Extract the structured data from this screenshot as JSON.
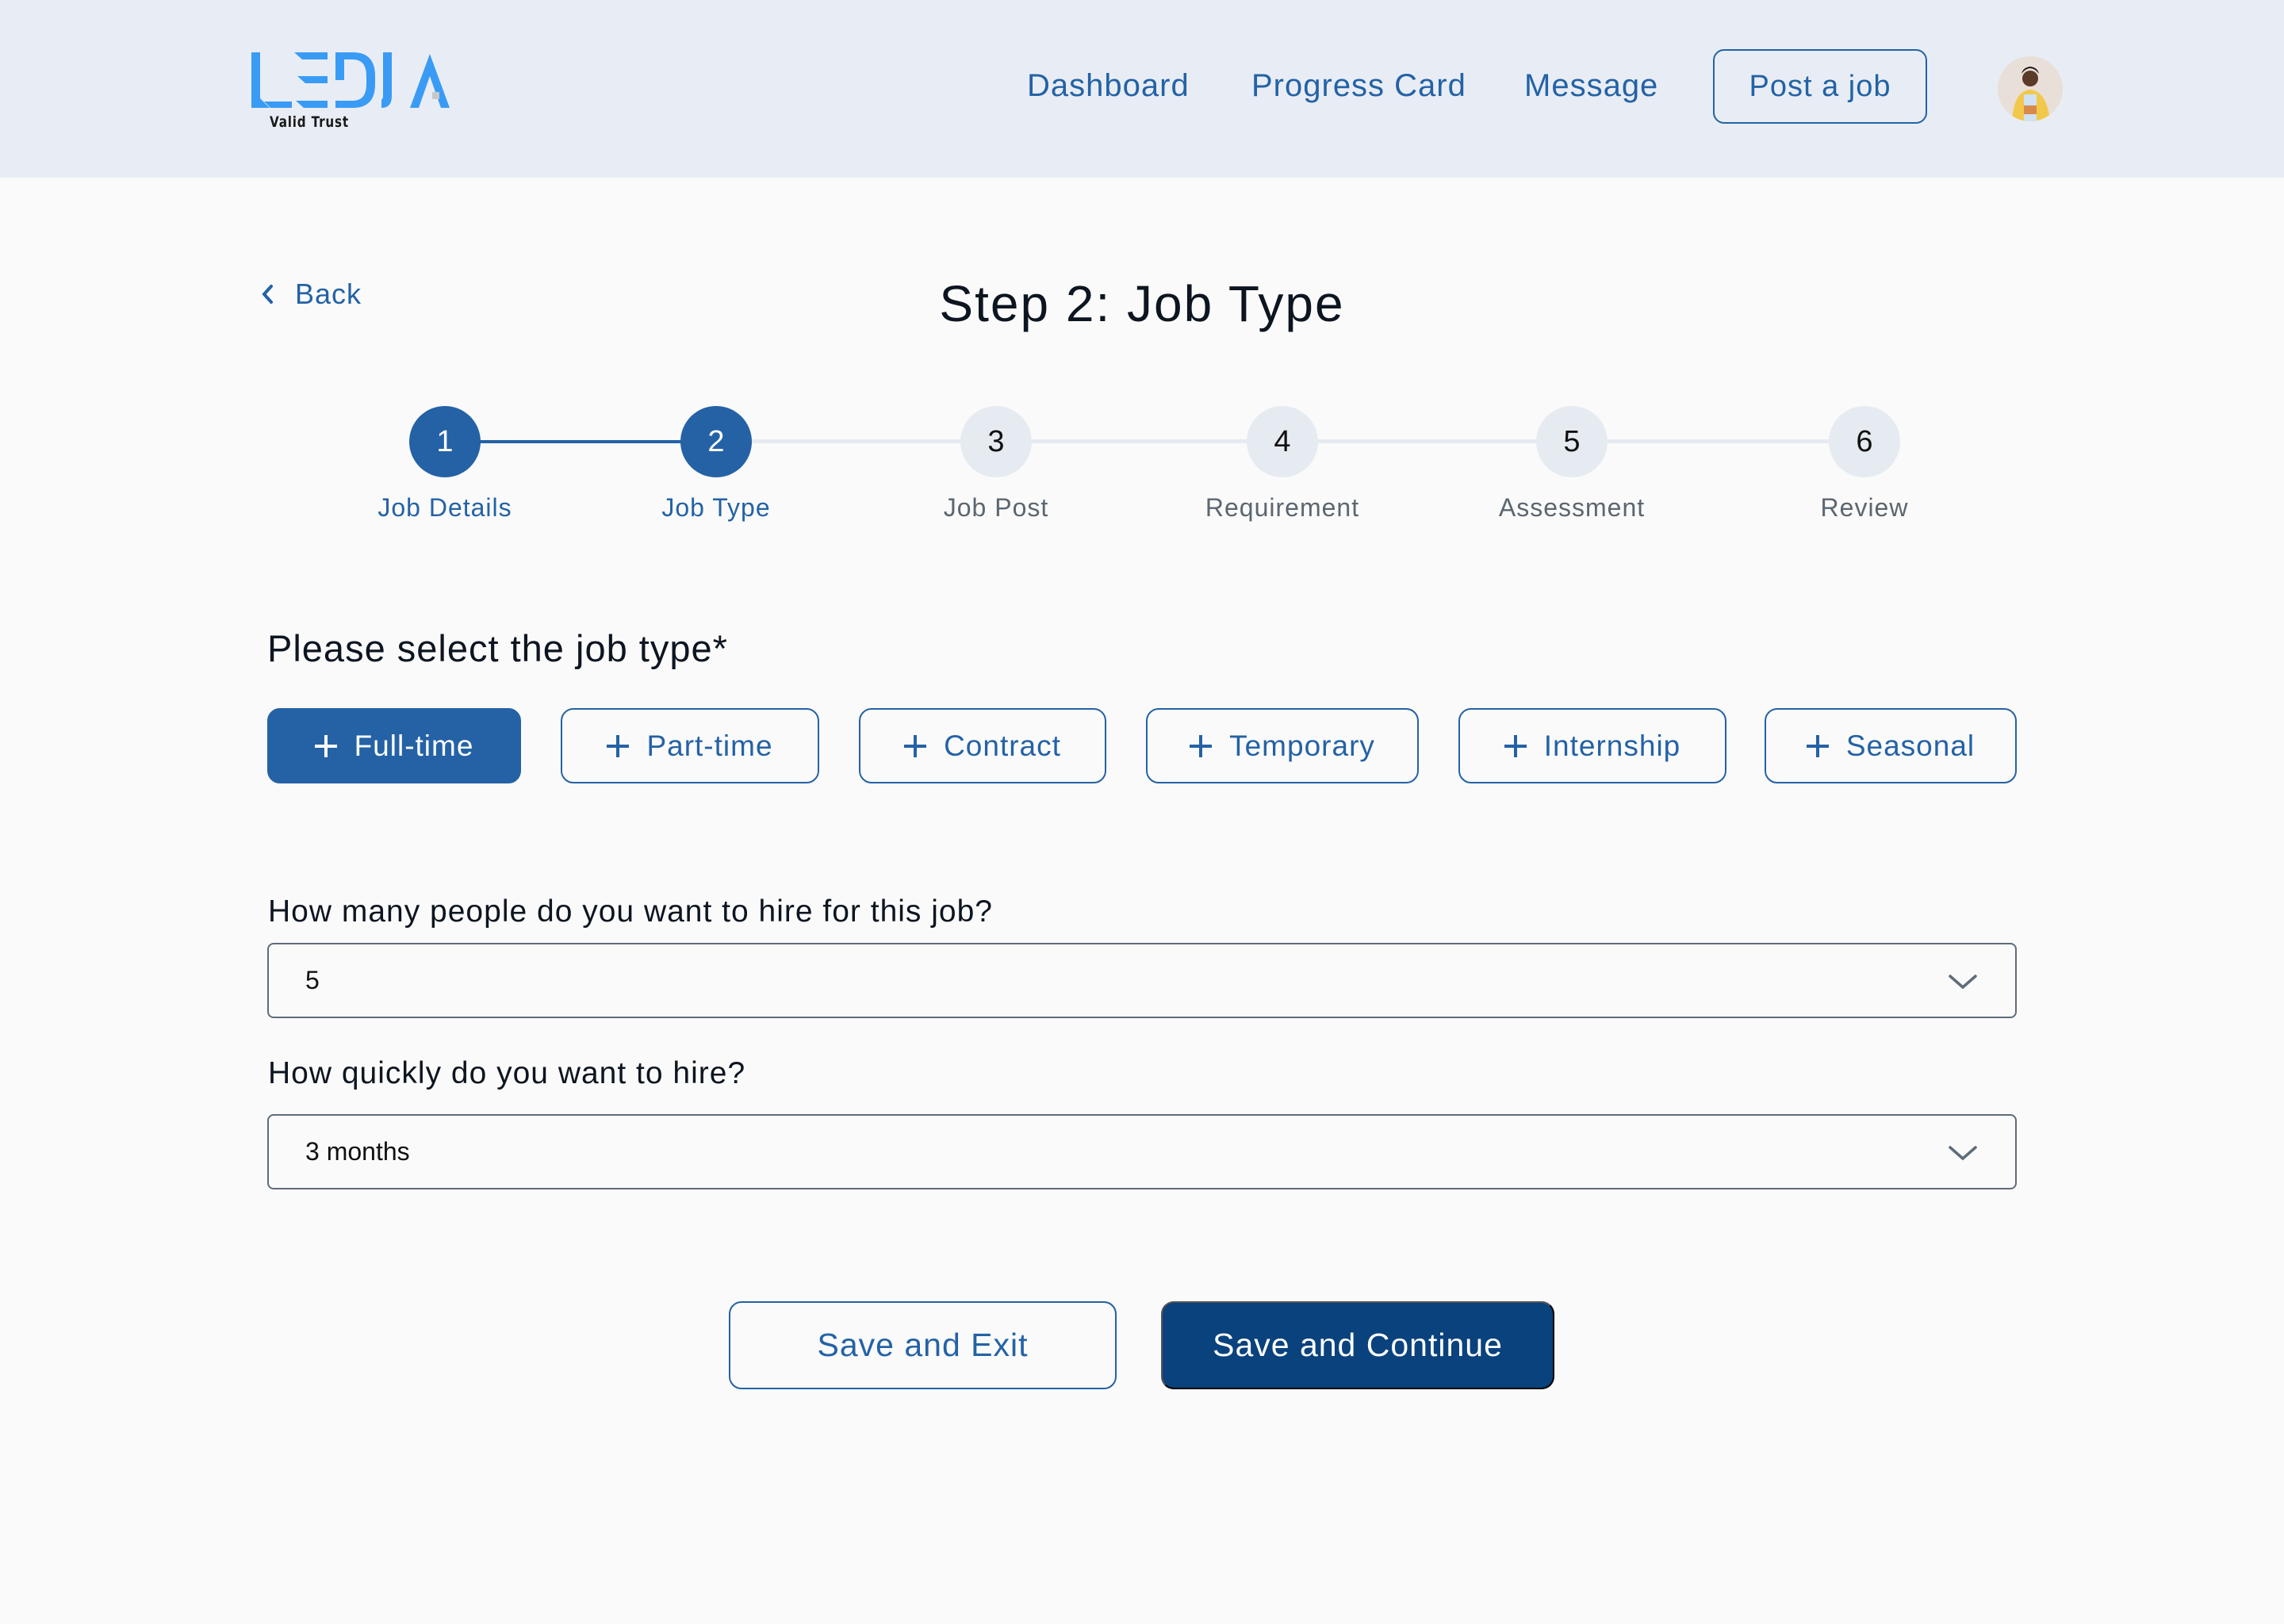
{
  "header": {
    "logo_text": "LEDJA",
    "logo_tagline": "Valid Trust",
    "nav": [
      {
        "label": "Dashboard"
      },
      {
        "label": "Progress Card"
      },
      {
        "label": "Message"
      }
    ],
    "post_job_label": "Post a job",
    "avatar_alt": "User avatar"
  },
  "page": {
    "back_label": "Back",
    "title": "Step 2: Job Type"
  },
  "stepper": {
    "current_step": 2,
    "steps": [
      {
        "number": "1",
        "label": "Job Details",
        "state": "complete"
      },
      {
        "number": "2",
        "label": "Job Type",
        "state": "active"
      },
      {
        "number": "3",
        "label": "Job Post",
        "state": "pending"
      },
      {
        "number": "4",
        "label": "Requirement",
        "state": "pending"
      },
      {
        "number": "5",
        "label": "Assessment",
        "state": "pending"
      },
      {
        "number": "6",
        "label": "Review",
        "state": "pending"
      }
    ]
  },
  "job_type": {
    "title": "Please select the job type*",
    "selected": "Full-time",
    "options": [
      {
        "label": "Full-time",
        "selected": true
      },
      {
        "label": "Part-time",
        "selected": false
      },
      {
        "label": "Contract",
        "selected": false
      },
      {
        "label": "Temporary",
        "selected": false
      },
      {
        "label": "Internship",
        "selected": false
      },
      {
        "label": "Seasonal",
        "selected": false
      }
    ]
  },
  "fields": {
    "hire_count": {
      "label": "How many people do you want to hire for this job?",
      "value": "5"
    },
    "hire_speed": {
      "label": "How quickly do you want to hire?",
      "value": "3 months"
    }
  },
  "actions": {
    "save_exit_label": "Save and Exit",
    "save_continue_label": "Save and Continue"
  },
  "colors": {
    "primary": "#2462a5",
    "primary_dark": "#0a427d",
    "logo_blue": "#3a9bf5",
    "header_bg": "#e8edf5",
    "step_pending": "#e6ebf2"
  }
}
